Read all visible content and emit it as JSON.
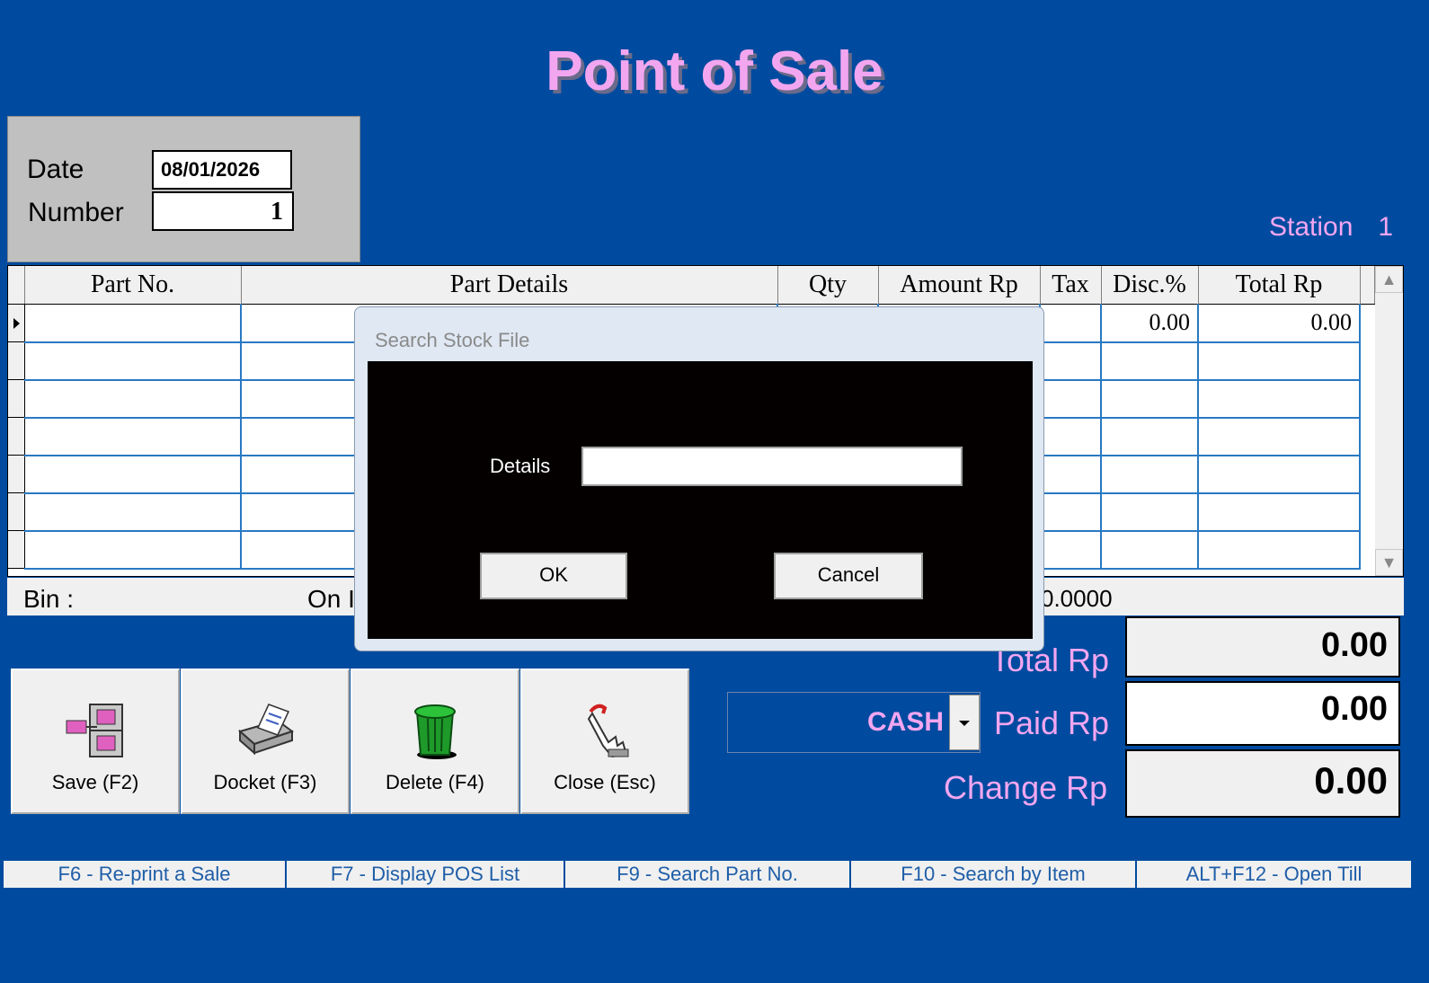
{
  "title": "Point of Sale",
  "header": {
    "date_label": "Date",
    "date_value": "08/01/2026",
    "number_label": "Number",
    "number_value": "1",
    "station_label": "Station",
    "station_value": "1"
  },
  "grid": {
    "columns": [
      "Part No.",
      "Part Details",
      "Qty",
      "Amount Rp",
      "Tax",
      "Disc.%",
      "Total Rp"
    ],
    "first_row": {
      "disc": "0.00",
      "total": "0.00"
    }
  },
  "info_bar": {
    "bin_label": "Bin :",
    "on_label": "On I",
    "value": "0.0000"
  },
  "buttons": {
    "save": {
      "label": "Save (F2)",
      "key": "S"
    },
    "docket": {
      "label": "Docket (F3)",
      "key": "o"
    },
    "delete": {
      "label": "Delete (F4)",
      "key": "D"
    },
    "close": {
      "label": "Close (Esc)",
      "key": "C"
    }
  },
  "payment": {
    "method": "CASH",
    "total_label": "Total Rp",
    "total_value": "0.00",
    "paid_label": "Paid Rp",
    "paid_value": "0.00",
    "change_label": "Change Rp",
    "change_value": "0.00"
  },
  "function_keys": [
    "F6 - Re-print a Sale",
    "F7 - Display POS List",
    "F9 - Search Part No.",
    "F10 - Search by Item",
    "ALT+F12 - Open Till"
  ],
  "dialog": {
    "title": "Search Stock File",
    "details_label": "Details",
    "details_value": "",
    "ok_label": "OK",
    "cancel_label": "Cancel"
  },
  "colors": {
    "background": "#004b9f",
    "accent_pink": "#f3a6f0",
    "grid_line": "#2979c4"
  }
}
